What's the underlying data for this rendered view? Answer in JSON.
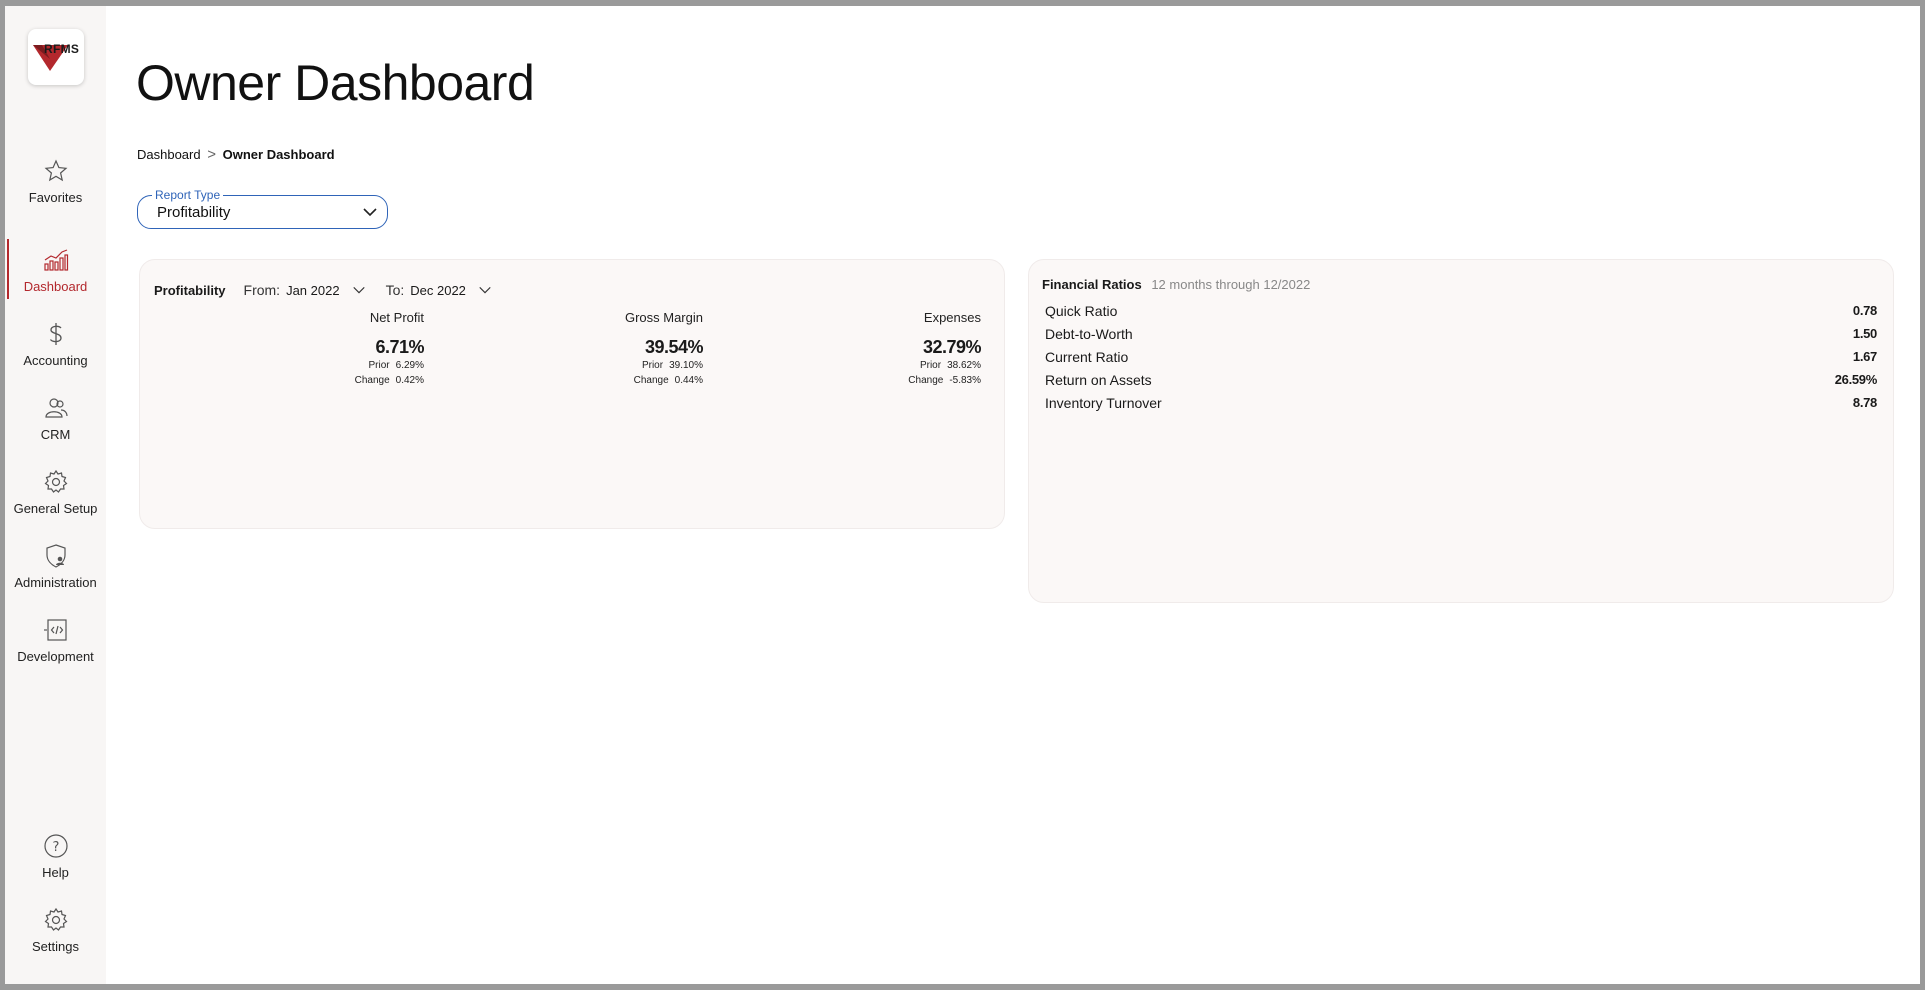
{
  "logo": {
    "text": "RFMS"
  },
  "sidebar": {
    "items": [
      {
        "label": "Favorites",
        "icon": "star-icon"
      },
      {
        "label": "Dashboard",
        "icon": "chart-icon",
        "active": true
      },
      {
        "label": "Accounting",
        "icon": "dollar-icon"
      },
      {
        "label": "CRM",
        "icon": "users-icon"
      },
      {
        "label": "General Setup",
        "icon": "gear-icon"
      },
      {
        "label": "Administration",
        "icon": "shield-user-icon"
      },
      {
        "label": "Development",
        "icon": "code-icon"
      }
    ],
    "bottom": [
      {
        "label": "Help",
        "icon": "question-icon"
      },
      {
        "label": "Settings",
        "icon": "gear-icon"
      }
    ]
  },
  "page": {
    "title": "Owner Dashboard"
  },
  "breadcrumb": {
    "root": "Dashboard",
    "separator": ">",
    "current": "Owner Dashboard"
  },
  "report_type": {
    "legend": "Report Type",
    "value": "Profitability"
  },
  "profitability": {
    "title": "Profitability",
    "from_label": "From:",
    "from_value": "Jan 2022",
    "to_label": "To:",
    "to_value": "Dec 2022",
    "metrics": [
      {
        "label": "Net Profit",
        "value": "6.71%",
        "prior_label": "Prior",
        "prior": "6.29%",
        "change_label": "Change",
        "change": "0.42%"
      },
      {
        "label": "Gross Margin",
        "value": "39.54%",
        "prior_label": "Prior",
        "prior": "39.10%",
        "change_label": "Change",
        "change": "0.44%"
      },
      {
        "label": "Expenses",
        "value": "32.79%",
        "prior_label": "Prior",
        "prior": "38.62%",
        "change_label": "Change",
        "change": "-5.83%"
      }
    ]
  },
  "financial_ratios": {
    "title": "Financial Ratios",
    "period": "12 months through 12/2022",
    "rows": [
      {
        "label": "Quick Ratio",
        "value": "0.78"
      },
      {
        "label": "Debt-to-Worth",
        "value": "1.50"
      },
      {
        "label": "Current Ratio",
        "value": "1.67"
      },
      {
        "label": "Return on Assets",
        "value": "26.59%"
      },
      {
        "label": "Inventory Turnover",
        "value": "8.78"
      }
    ]
  },
  "colors": {
    "accent": "#b3282d",
    "focus": "#2f64b8",
    "sidebar_bg": "#f8f6f5",
    "card_bg": "#fbf8f7"
  }
}
